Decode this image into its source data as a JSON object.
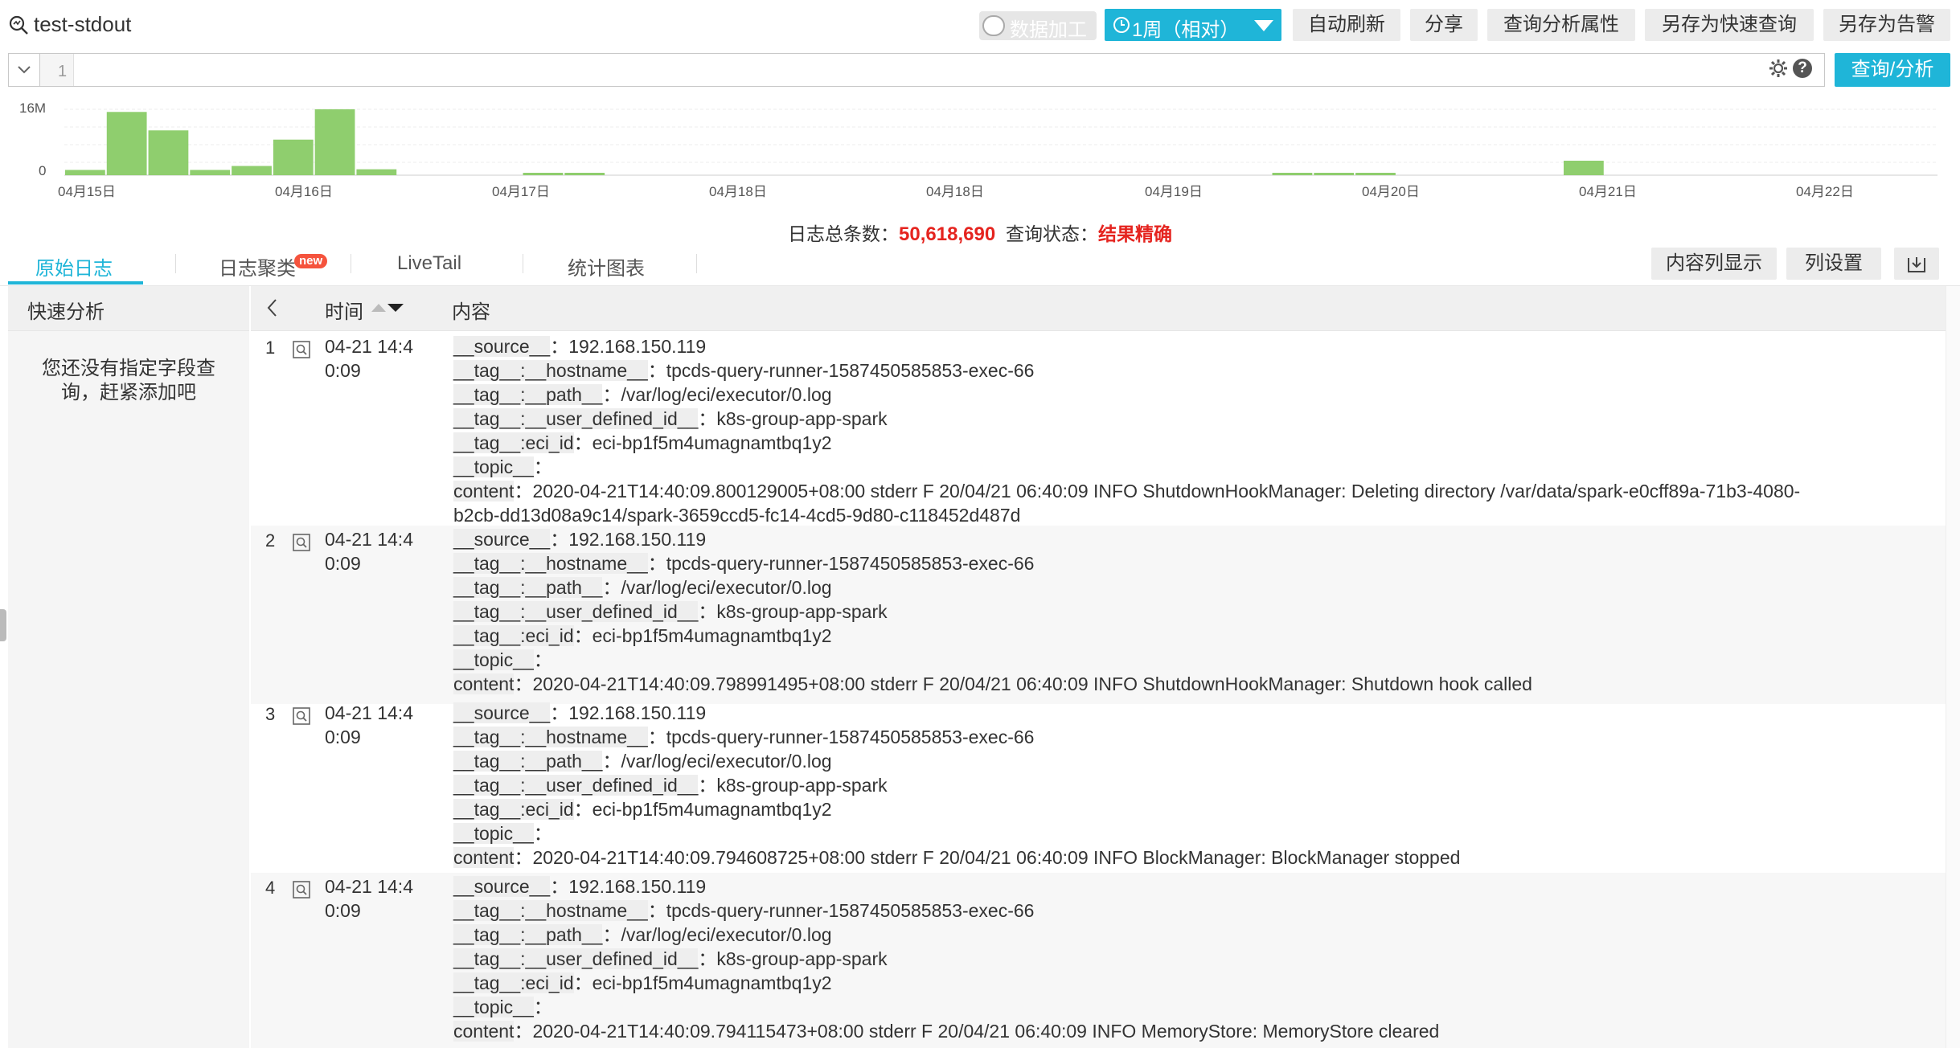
{
  "header": {
    "title": "test-stdout",
    "data_processing_label": "数据加工",
    "time_range_label": "1周（相对）",
    "buttons": [
      "自动刷新",
      "分享",
      "查询分析属性",
      "另存为快速查询",
      "另存为告警"
    ]
  },
  "query": {
    "line_number": "1",
    "help_label": "?",
    "search_button": "查询/分析"
  },
  "histogram": {
    "y_max_label": "16M",
    "y_min_label": "0",
    "x_labels": [
      "04月15日",
      "04月16日",
      "04月17日",
      "04月18日",
      "04月18日",
      "04月19日",
      "04月20日",
      "04月21日",
      "04月22日"
    ],
    "bar_color": "#8fce6e",
    "bars": [
      0.08,
      0.96,
      0.68,
      0.08,
      0.14,
      0.54,
      1.0,
      0.09,
      0,
      0,
      0,
      0.02,
      0.02,
      0,
      0,
      0,
      0,
      0,
      0,
      0,
      0,
      0,
      0,
      0,
      0,
      0,
      0,
      0,
      0,
      0.02,
      0.02,
      0.02,
      0,
      0,
      0,
      0,
      0.22,
      0,
      0,
      0,
      0,
      0,
      0,
      0,
      0
    ]
  },
  "summary": {
    "total_label": "日志总条数：",
    "total_value": "50,618,690",
    "status_label": "查询状态：",
    "status_value": "结果精确"
  },
  "tabs": {
    "items": [
      "原始日志",
      "日志聚类",
      "LiveTail",
      "统计图表"
    ],
    "new_badge": "new",
    "right_buttons": [
      "内容列显示",
      "列设置"
    ]
  },
  "left_panel": {
    "title": "快速分析",
    "empty_text": "您还没有指定字段查询，赶紧添加吧"
  },
  "table": {
    "col_time": "时间",
    "col_content": "内容",
    "rows": [
      {
        "index": "1",
        "time_line1": "04-21 14:4",
        "time_line2": "0:09",
        "fields": [
          {
            "k": "__source__",
            "v": "192.168.150.119"
          },
          {
            "k": "__tag__:__hostname__",
            "v": "tpcds-query-runner-1587450585853-exec-66"
          },
          {
            "k": "__tag__:__path__",
            "v": "/var/log/eci/executor/0.log"
          },
          {
            "k": "__tag__:__user_defined_id__",
            "v": "k8s-group-app-spark"
          },
          {
            "k": "__tag__:eci_id",
            "v": "eci-bp1f5m4umagnamtbq1y2"
          },
          {
            "k": "__topic__",
            "v": ""
          },
          {
            "k": "content",
            "v": "2020-04-21T14:40:09.800129005+08:00 stderr F 20/04/21 06:40:09 INFO ShutdownHookManager: Deleting directory /var/data/spark-e0cff89a-71b3-4080-"
          }
        ],
        "continuation": "b2cb-dd13d08a9c14/spark-3659ccd5-fc14-4cd5-9d80-c118452d487d"
      },
      {
        "index": "2",
        "time_line1": "04-21 14:4",
        "time_line2": "0:09",
        "fields": [
          {
            "k": "__source__",
            "v": "192.168.150.119"
          },
          {
            "k": "__tag__:__hostname__",
            "v": "tpcds-query-runner-1587450585853-exec-66"
          },
          {
            "k": "__tag__:__path__",
            "v": "/var/log/eci/executor/0.log"
          },
          {
            "k": "__tag__:__user_defined_id__",
            "v": "k8s-group-app-spark"
          },
          {
            "k": "__tag__:eci_id",
            "v": "eci-bp1f5m4umagnamtbq1y2"
          },
          {
            "k": "__topic__",
            "v": ""
          },
          {
            "k": "content",
            "v": "2020-04-21T14:40:09.798991495+08:00 stderr F 20/04/21 06:40:09 INFO ShutdownHookManager: Shutdown hook called"
          }
        ],
        "continuation": ""
      },
      {
        "index": "3",
        "time_line1": "04-21 14:4",
        "time_line2": "0:09",
        "fields": [
          {
            "k": "__source__",
            "v": "192.168.150.119"
          },
          {
            "k": "__tag__:__hostname__",
            "v": "tpcds-query-runner-1587450585853-exec-66"
          },
          {
            "k": "__tag__:__path__",
            "v": "/var/log/eci/executor/0.log"
          },
          {
            "k": "__tag__:__user_defined_id__",
            "v": "k8s-group-app-spark"
          },
          {
            "k": "__tag__:eci_id",
            "v": "eci-bp1f5m4umagnamtbq1y2"
          },
          {
            "k": "__topic__",
            "v": ""
          },
          {
            "k": "content",
            "v": "2020-04-21T14:40:09.794608725+08:00 stderr F 20/04/21 06:40:09 INFO BlockManager: BlockManager stopped"
          }
        ],
        "continuation": ""
      },
      {
        "index": "4",
        "time_line1": "04-21 14:4",
        "time_line2": "0:09",
        "fields": [
          {
            "k": "__source__",
            "v": "192.168.150.119"
          },
          {
            "k": "__tag__:__hostname__",
            "v": "tpcds-query-runner-1587450585853-exec-66"
          },
          {
            "k": "__tag__:__path__",
            "v": "/var/log/eci/executor/0.log"
          },
          {
            "k": "__tag__:__user_defined_id__",
            "v": "k8s-group-app-spark"
          },
          {
            "k": "__tag__:eci_id",
            "v": "eci-bp1f5m4umagnamtbq1y2"
          },
          {
            "k": "__topic__",
            "v": ""
          },
          {
            "k": "content",
            "v": "2020-04-21T14:40:09.794115473+08:00 stderr F 20/04/21 06:40:09 INFO MemoryStore: MemoryStore cleared"
          }
        ],
        "continuation": ""
      }
    ]
  }
}
